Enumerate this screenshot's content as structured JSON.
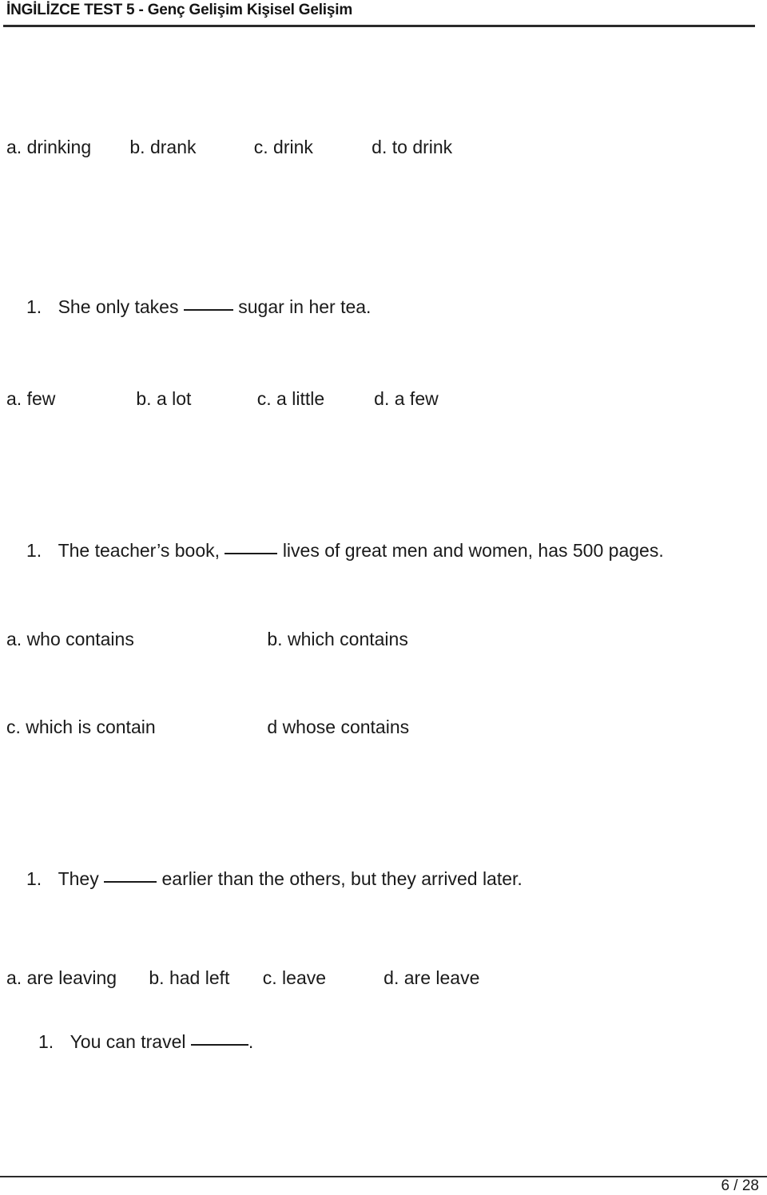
{
  "header": {
    "title": "İNGİLİZCE TEST 5  - Genç Gelişim Kişisel Gelişim"
  },
  "content": {
    "blocks": [
      {
        "kind": "options",
        "options": [
          {
            "label": "a. drinking"
          },
          {
            "label": "b. drank"
          },
          {
            "label": "c. drink"
          },
          {
            "label": "d. to drink"
          }
        ]
      },
      {
        "kind": "question",
        "number": "1.",
        "text_before": "She only takes",
        "text_after": "sugar in her tea."
      },
      {
        "kind": "options",
        "options": [
          {
            "label": "a. few"
          },
          {
            "label": "b. a lot"
          },
          {
            "label": "c. a little"
          },
          {
            "label": "d. a few"
          }
        ]
      },
      {
        "kind": "question",
        "number": "1.",
        "text_before": "The teacher’s book,",
        "text_after": "lives of great men and women, has 500 pages."
      },
      {
        "kind": "options",
        "options": [
          {
            "label": "a. who contains"
          },
          {
            "label": "b. which contains"
          }
        ]
      },
      {
        "kind": "options",
        "options": [
          {
            "label": "c. which is contain"
          },
          {
            "label": "d whose contains"
          }
        ]
      },
      {
        "kind": "question",
        "number": "1.",
        "text_before": "They",
        "text_after": "earlier than the others, but they arrived later."
      },
      {
        "kind": "options",
        "options": [
          {
            "label": "a. are leaving"
          },
          {
            "label": "b. had left"
          },
          {
            "label": "c. leave"
          },
          {
            "label": "d. are leave"
          }
        ]
      },
      {
        "kind": "question",
        "number": "1.",
        "text_before": "You can travel",
        "text_after": "."
      }
    ]
  },
  "footer": {
    "page_indicator": "6 / 28"
  }
}
